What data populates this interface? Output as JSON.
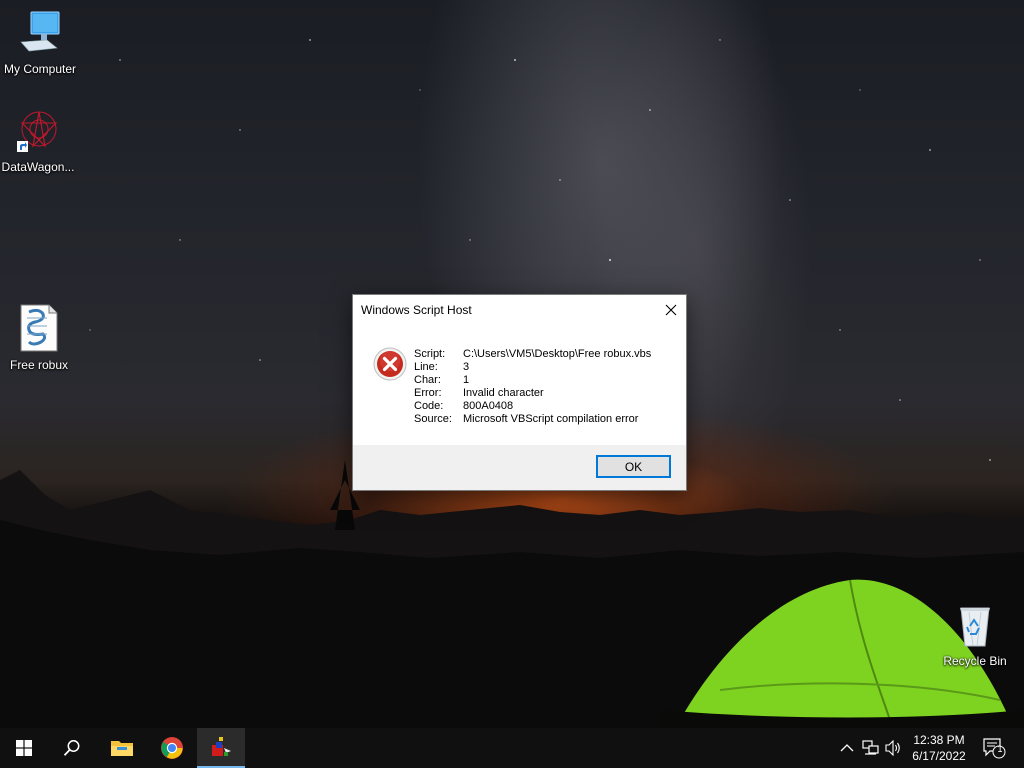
{
  "desktop": {
    "icons": [
      {
        "label": "My Computer",
        "icon": "monitor-icon"
      },
      {
        "label": "DataWagon...",
        "icon": "shortcut-icon"
      },
      {
        "label": "Free robux",
        "icon": "vbs-script-icon"
      },
      {
        "label": "Recycle Bin",
        "icon": "recycle-bin-icon"
      }
    ]
  },
  "dialog": {
    "title": "Windows Script Host",
    "icon": "error-icon",
    "fields": [
      {
        "key": "Script:",
        "value": "C:\\Users\\VM5\\Desktop\\Free robux.vbs"
      },
      {
        "key": "Line:",
        "value": "3"
      },
      {
        "key": "Char:",
        "value": "1"
      },
      {
        "key": "Error:",
        "value": "Invalid character"
      },
      {
        "key": "Code:",
        "value": "800A0408"
      },
      {
        "key": "Source:",
        "value": "Microsoft VBScript compilation error"
      }
    ],
    "ok_label": "OK"
  },
  "taskbar": {
    "buttons": [
      "windows-start-icon",
      "search-icon",
      "file-explorer-icon",
      "chrome-icon",
      "app-icon"
    ],
    "tray": {
      "icons": [
        "chevron-up-icon",
        "network-icon",
        "volume-icon"
      ],
      "time": "12:38 PM",
      "date": "6/17/2022",
      "notification_count": "1"
    }
  },
  "colors": {
    "accent": "#0078d7",
    "error_red": "#c42b1c",
    "taskbar": "#101010"
  }
}
